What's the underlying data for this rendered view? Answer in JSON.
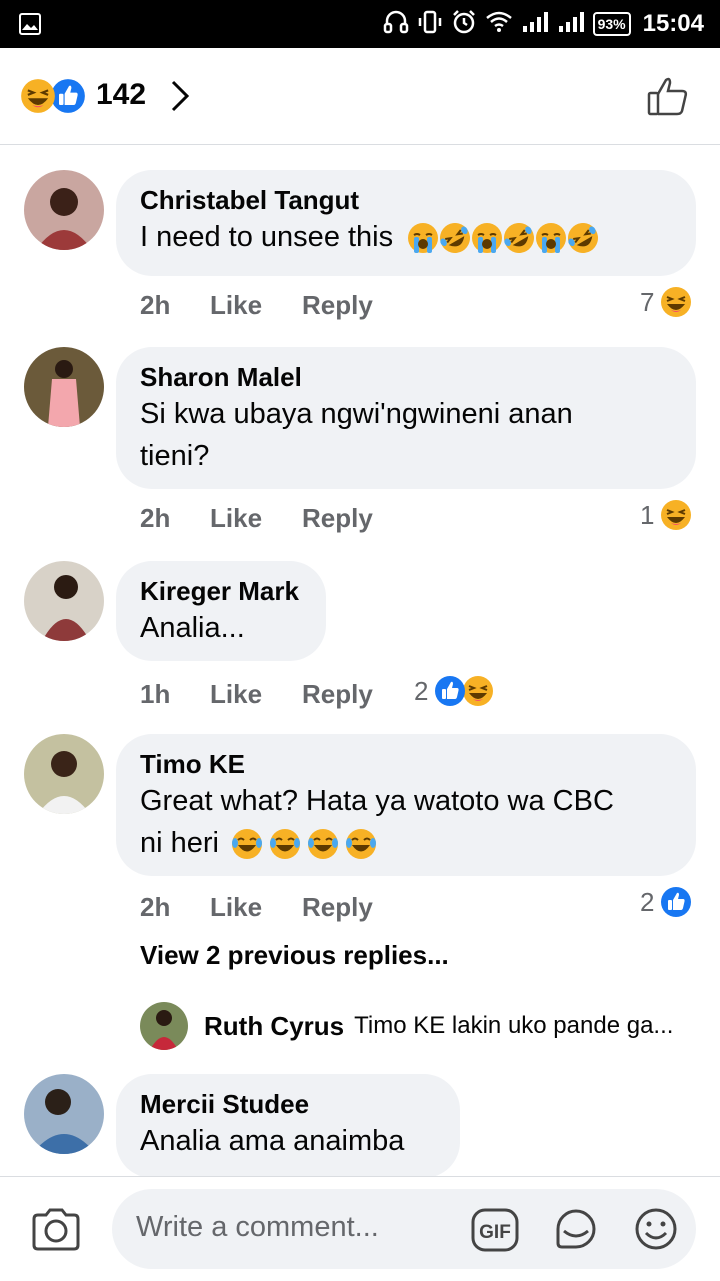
{
  "status_bar": {
    "time": "15:04",
    "battery": "93%"
  },
  "header": {
    "reaction_count": "142",
    "reaction_icons": [
      "haha-icon",
      "like-icon"
    ]
  },
  "comments": [
    {
      "name": "Christabel Tangut",
      "text": "I need to unsee this",
      "emojis": [
        "crying-face-icon",
        "rofl-icon",
        "crying-face-icon",
        "rofl-icon",
        "crying-face-icon",
        "rofl-icon"
      ],
      "time": "2h",
      "like": "Like",
      "reply": "Reply",
      "reaction_count": "7",
      "reactions": [
        "haha-icon"
      ]
    },
    {
      "name": "Sharon Malel",
      "text_line1": "Si kwa ubaya ngwi'ngwineni anan",
      "text_line2": "tieni?",
      "time": "2h",
      "like": "Like",
      "reply": "Reply",
      "reaction_count": "1",
      "reactions": [
        "haha-icon"
      ]
    },
    {
      "name": "Kireger Mark",
      "text": "Analia...",
      "time": "1h",
      "like": "Like",
      "reply": "Reply",
      "reaction_count": "2",
      "reactions": [
        "like-icon",
        "haha-icon"
      ]
    },
    {
      "name": "Timo KE",
      "text_line1": "Great what? Hata ya watoto wa CBC",
      "text_line2": "ni heri",
      "emojis": [
        "tears-of-joy-icon",
        "tears-of-joy-icon",
        "tears-of-joy-icon",
        "tears-of-joy-icon"
      ],
      "time": "2h",
      "like": "Like",
      "reply": "Reply",
      "reaction_count": "2",
      "reactions": [
        "like-icon"
      ]
    },
    {
      "name": "Mercii Studee",
      "text": "Analia ama anaimba"
    }
  ],
  "view_previous": "View 2 previous replies...",
  "reply_preview": {
    "name": "Ruth Cyrus",
    "text": "Timo KE lakin uko pande ga..."
  },
  "composer": {
    "placeholder": "Write a comment...",
    "gif_label": "GIF"
  },
  "colors": {
    "like_blue": "#1877f2",
    "haha_yellow": "#f7b125",
    "bubble": "#f0f2f5",
    "meta_gray": "#65676b"
  }
}
